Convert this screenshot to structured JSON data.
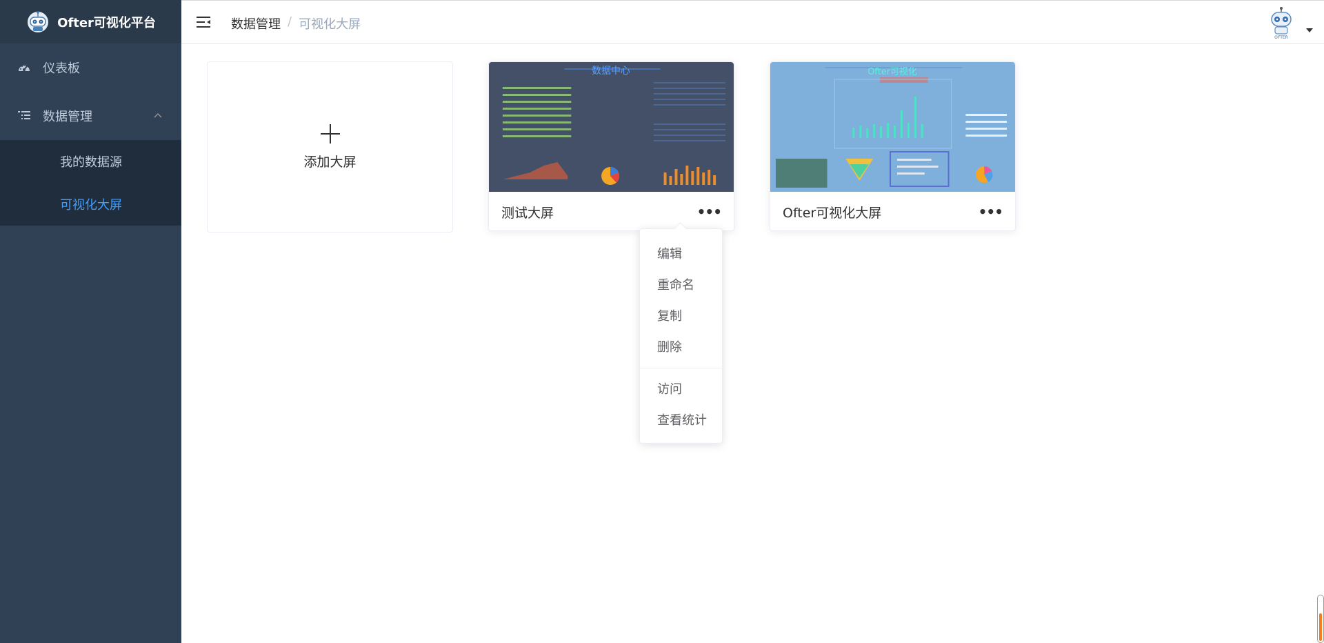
{
  "app": {
    "title": "Ofter可视化平台"
  },
  "sidebar": {
    "dashboard_label": "仪表板",
    "data_mgmt_label": "数据管理",
    "sub_items": [
      "我的数据源",
      "可视化大屏"
    ],
    "active_sub": "可视化大屏"
  },
  "header": {
    "breadcrumb": [
      "数据管理",
      "可视化大屏"
    ],
    "breadcrumb_sep": "/"
  },
  "cards": {
    "add_label": "添加大屏",
    "items": [
      {
        "title": "测试大屏",
        "thumb_heading": "数据中心"
      },
      {
        "title": "Ofter可视化大屏",
        "thumb_heading": "Ofter可视化"
      }
    ]
  },
  "dropdown": {
    "items": [
      "编辑",
      "重命名",
      "复制",
      "删除"
    ],
    "items_after_divider": [
      "访问",
      "查看统计"
    ]
  },
  "colors": {
    "sidebar_bg": "#304156",
    "active": "#409eff",
    "thumb1_bg": "#435068",
    "thumb2_bg": "#7fb0dc"
  }
}
